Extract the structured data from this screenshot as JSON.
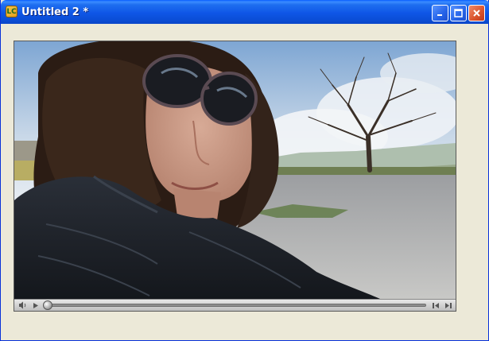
{
  "window": {
    "title": "Untitled 2 *",
    "app_icon_label": "LC",
    "icon_names": [
      "app-icon",
      "minimize-icon",
      "maximize-icon",
      "close-icon"
    ]
  },
  "player": {
    "controls": [
      "volume-icon",
      "play-icon",
      "seek-slider",
      "step-back-icon",
      "step-forward-icon"
    ],
    "playback_position": 0.0
  },
  "colors": {
    "titlebar": "#0b4fd8",
    "window_face": "#ece9d8",
    "close_button": "#d9532b"
  }
}
